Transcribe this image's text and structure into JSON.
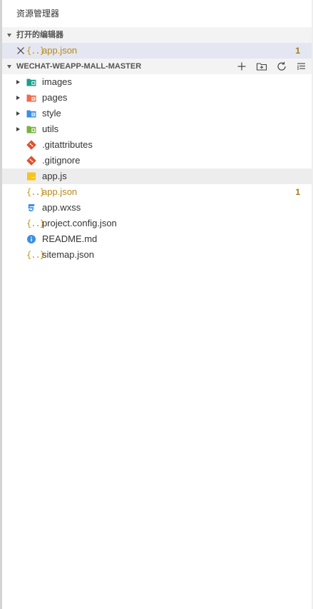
{
  "explorer": {
    "title": "资源管理器"
  },
  "open_editors": {
    "header": "打开的编辑器",
    "items": [
      {
        "name": "app.json",
        "icon": "json-icon",
        "badge": "1"
      }
    ]
  },
  "workspace": {
    "header": "WECHAT-WEAPP-MALL-MASTER",
    "actions": [
      "new-file-icon",
      "new-folder-icon",
      "refresh-icon",
      "collapse-all-icon"
    ],
    "folders": [
      {
        "name": "images",
        "color": "#1e9e8a"
      },
      {
        "name": "pages",
        "color": "#f26b4f"
      },
      {
        "name": "style",
        "color": "#3b8fe4"
      },
      {
        "name": "utils",
        "color": "#79b340"
      }
    ],
    "files": [
      {
        "name": ".gitattributes",
        "icon": "git-icon"
      },
      {
        "name": ".gitignore",
        "icon": "git-icon"
      },
      {
        "name": "app.js",
        "icon": "js-icon"
      },
      {
        "name": "app.json",
        "icon": "json-icon",
        "badge": "1"
      },
      {
        "name": "app.wxss",
        "icon": "css-icon"
      },
      {
        "name": "project.config.json",
        "icon": "json-icon"
      },
      {
        "name": "README.md",
        "icon": "info-icon"
      },
      {
        "name": "sitemap.json",
        "icon": "json-icon"
      }
    ]
  },
  "colors": {
    "json": "#c49a1c",
    "git": "#e0512d",
    "js": "#f5c518",
    "css": "#3b8fe4",
    "info": "#3b8fe4",
    "modified_text": "#b58a1a"
  }
}
